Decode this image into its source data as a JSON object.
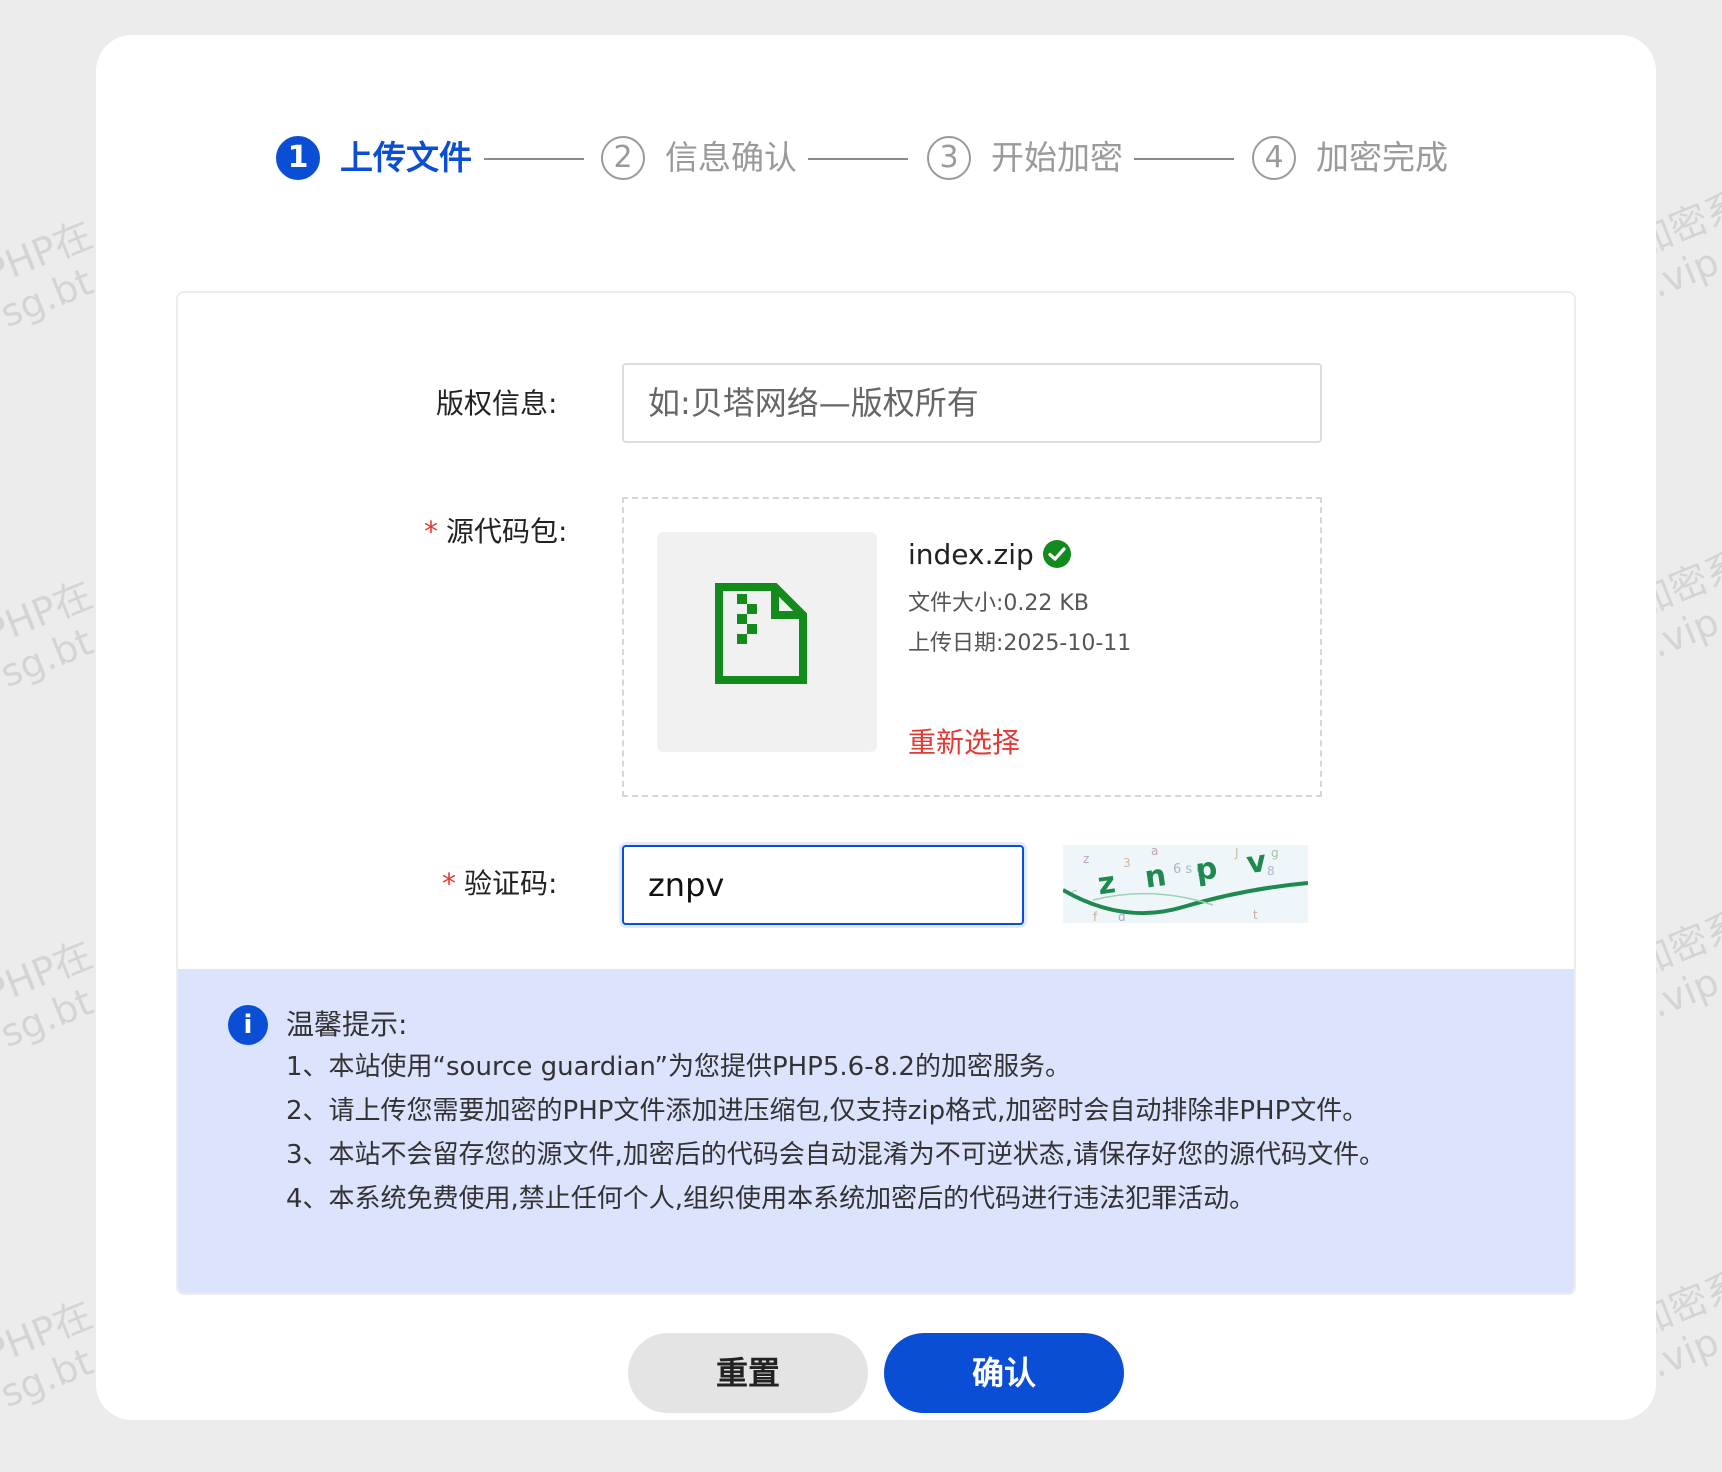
{
  "watermark": {
    "left_text": "PHP在\nsg.bt",
    "right_text": "加密系\n.vip"
  },
  "steps": [
    {
      "number": "1",
      "label": "上传文件",
      "active": true
    },
    {
      "number": "2",
      "label": "信息确认",
      "active": false
    },
    {
      "number": "3",
      "label": "开始加密",
      "active": false
    },
    {
      "number": "4",
      "label": "加密完成",
      "active": false
    }
  ],
  "form": {
    "copyright_label": "版权信息:",
    "copyright_placeholder": "如:贝塔网络—版权所有",
    "copyright_value": "",
    "source_required_mark": "*",
    "source_label": "源代码包:",
    "file": {
      "icon": "zip-file-icon",
      "name": "index.zip",
      "status_icon": "check-circle-icon",
      "size_label": "文件大小:",
      "size_value": "0.22 KB",
      "date_label": "上传日期:",
      "date_value": "2025-10-11",
      "reselect_label": "重新选择"
    },
    "captcha_required_mark": "*",
    "captcha_label": "验证码:",
    "captcha_value": "znpv",
    "captcha_image_text": "znpv"
  },
  "tips": {
    "icon": "info-icon",
    "icon_glyph": "i",
    "title": "温馨提示:",
    "lines": [
      "1、本站使用“source guardian”为您提供PHP5.6-8.2的加密服务。",
      "2、请上传您需要加密的PHP文件添加进压缩包,仅支持zip格式,加密时会自动排除非PHP文件。",
      "3、本站不会留存您的源文件,加密后的代码会自动混淆为不可逆状态,请保存好您的源代码文件。",
      "4、本系统免费使用,禁止任何个人,组织使用本系统加密后的代码进行违法犯罪活动。"
    ]
  },
  "buttons": {
    "reset": "重置",
    "confirm": "确认"
  },
  "colors": {
    "accent": "#0a4ed6",
    "success": "#138a1c",
    "danger": "#e53935",
    "tips_bg": "#dbe3fd"
  }
}
